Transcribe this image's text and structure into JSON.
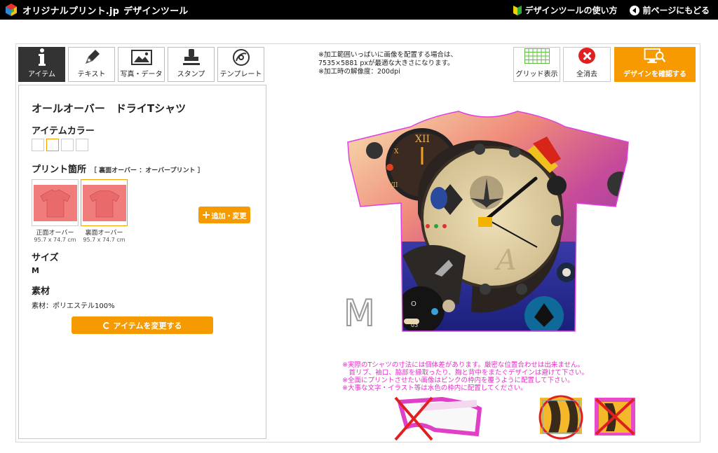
{
  "header": {
    "brand": "オリジナルプリント.jp",
    "app_name": "デザインツール",
    "help_link": "デザインツールの使い方",
    "back_link": "前ページにもどる"
  },
  "tool_tabs": [
    {
      "label": "アイテム",
      "icon": "info-icon",
      "active": true
    },
    {
      "label": "テキスト",
      "icon": "pen-icon",
      "active": false
    },
    {
      "label": "写真・データ",
      "icon": "image-icon",
      "active": false
    },
    {
      "label": "スタンプ",
      "icon": "stamp-icon",
      "active": false
    },
    {
      "label": "テンプレート",
      "icon": "template-icon",
      "active": false
    }
  ],
  "item_panel": {
    "title": "オールオーバー　ドライTシャツ",
    "color_heading": "アイテムカラー",
    "print_heading": "プリント箇所",
    "print_sub": "［ 裏面オーバー ：オーバープリント ］",
    "print_locations": [
      {
        "name": "正面オーバー",
        "size": "95.7 x 74.7 cm",
        "selected": false
      },
      {
        "name": "裏面オーバー",
        "size": "95.7 x 74.7 cm",
        "selected": true
      }
    ],
    "add_button": "追加・変更",
    "size_heading": "サイズ",
    "size_value": "M",
    "material_heading": "素材",
    "material_value": "素材：ポリエステル100%",
    "change_button": "アイテムを変更する"
  },
  "top_note": [
    "※加工範囲いっぱいに画像を配置する場合は、",
    "7535×5881 pxが最適な大きさになります。",
    "※加工時の解像度：200dpi"
  ],
  "actions": {
    "grid": "グリッド表示",
    "clear": "全消去",
    "confirm": "デザインを確認する"
  },
  "canvas": {
    "size_label": "M"
  },
  "pink_notes": [
    "※実際のTシャツの寸法には個体差があります。厳密な位置合わせは出来ません。",
    "　首リブ、袖口、脇部を縁取ったり、胸と背中をまたぐデザインは避けて下さい。",
    "※全面にプリントさせたい画像はピンクの枠内を覆うように配置して下さい。",
    "※大事な文字・イラスト等は水色の枠内に配置してください。"
  ],
  "colors": {
    "accent": "#f79a00",
    "pink_note": "#e42fc8",
    "header_bg": "#000000"
  }
}
